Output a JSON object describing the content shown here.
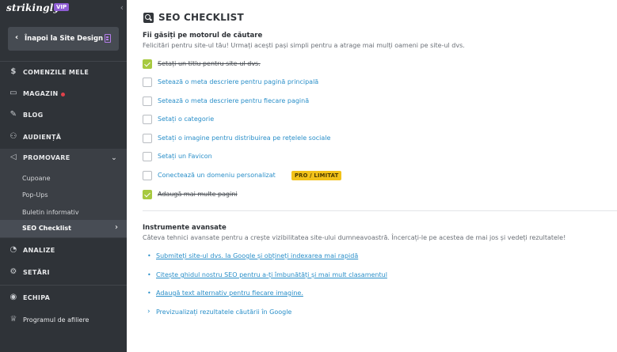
{
  "app": {
    "brand": "strikingly",
    "vip_badge": "VIP",
    "back_button": "Înapoi la Site Design"
  },
  "sidebar": {
    "items": [
      {
        "label": "COMENZILE MELE",
        "icon": "dollar-circle-icon"
      },
      {
        "label": "MAGAZIN",
        "icon": "store-icon",
        "notification": true
      },
      {
        "label": "BLOG",
        "icon": "pen-icon"
      },
      {
        "label": "AUDIENȚĂ",
        "icon": "audience-icon"
      },
      {
        "label": "PROMOVARE",
        "icon": "megaphone-icon",
        "expanded": true
      },
      {
        "label": "ANALIZE",
        "icon": "analytics-icon"
      },
      {
        "label": "SETĂRI",
        "icon": "gear-icon"
      },
      {
        "label": "ECHIPA",
        "icon": "team-icon"
      },
      {
        "label": "Programul de afiliere",
        "icon": "trophy-icon"
      }
    ],
    "promo_sub": [
      "Cupoane",
      "Pop-Ups",
      "Buletin informativ",
      "SEO Checklist"
    ],
    "active_sub": "SEO Checklist"
  },
  "main": {
    "title": "SEO CHECKLIST",
    "section1": {
      "title": "Fii găsiți pe motorul de căutare",
      "desc": "Felicitări pentru site-ul tău! Urmați acești pași simpli pentru a atrage mai mulți oameni pe site-ul dvs."
    },
    "checklist": [
      {
        "label": "Setați un titlu pentru site-ul dvs.",
        "done": true
      },
      {
        "label": "Setează o meta descriere pentru pagină principală",
        "done": false
      },
      {
        "label": "Setează o meta descriere pentru fiecare pagină",
        "done": false
      },
      {
        "label": "Setați o categorie",
        "done": false
      },
      {
        "label": "Setați o imagine pentru distribuirea pe rețelele sociale",
        "done": false
      },
      {
        "label": "Setați un Favicon",
        "done": false
      },
      {
        "label": "Conectează un domeniu personalizat",
        "done": false,
        "badge": "PRO / LIMITAT"
      },
      {
        "label": "Adaugă mai multe pagini",
        "done": true
      }
    ],
    "section2": {
      "title": "Instrumente avansate",
      "desc": "Câteva tehnici avansate pentru a crește vizibilitatea site-ului dumneavoastră. Încercați-le pe acestea de mai jos și vedeți rezultatele!"
    },
    "tools": [
      "Submiteți site-ul dvs. la Google și obțineți indexarea mai rapidă",
      "Citește ghidul nostru SEO pentru a-ți îmbunătăți și mai mult clasamentul",
      "Adaugă text alternativ pentru fiecare imagine."
    ],
    "preview_link": "Previzualizați rezultatele căutării în Google"
  },
  "colors": {
    "sidebar_bg": "#2f3338",
    "link": "#2a8fc9",
    "check_green": "#a7c940",
    "badge_yellow": "#f2c21a",
    "vip_purple": "#8e5cd4"
  }
}
